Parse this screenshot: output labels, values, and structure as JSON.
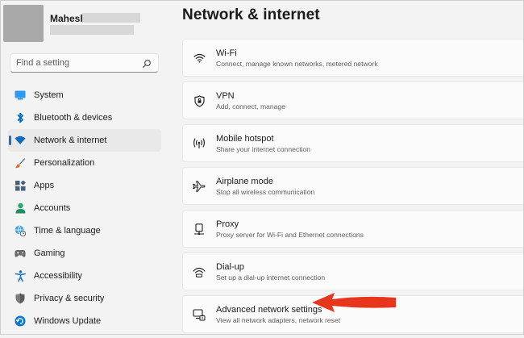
{
  "user": {
    "name": "Mahesh"
  },
  "search": {
    "placeholder": "Find a setting"
  },
  "sidebar": {
    "items": [
      {
        "label": "System",
        "icon": "system-icon",
        "color": "#0078d4"
      },
      {
        "label": "Bluetooth & devices",
        "icon": "bluetooth-icon",
        "color": "#0067c0"
      },
      {
        "label": "Network & internet",
        "icon": "wifi-icon",
        "color": "#0067c0",
        "selected": true
      },
      {
        "label": "Personalization",
        "icon": "brush-icon",
        "color": "#e06a2b"
      },
      {
        "label": "Apps",
        "icon": "apps-icon",
        "color": "#3a5f8a"
      },
      {
        "label": "Accounts",
        "icon": "person-icon",
        "color": "#2aa86a"
      },
      {
        "label": "Time & language",
        "icon": "globe-clock-icon",
        "color": "#1a8fd6"
      },
      {
        "label": "Gaming",
        "icon": "gamepad-icon",
        "color": "#6b6b6b"
      },
      {
        "label": "Accessibility",
        "icon": "accessibility-icon",
        "color": "#1a73c9"
      },
      {
        "label": "Privacy & security",
        "icon": "shield-icon",
        "color": "#6b6b6b"
      },
      {
        "label": "Windows Update",
        "icon": "update-icon",
        "color": "#0a78d1"
      }
    ]
  },
  "page": {
    "title": "Network & internet"
  },
  "cards": [
    {
      "title": "Wi-Fi",
      "desc": "Connect, manage known networks, metered network",
      "icon": "wifi-icon"
    },
    {
      "title": "VPN",
      "desc": "Add, connect, manage",
      "icon": "vpn-shield-icon"
    },
    {
      "title": "Mobile hotspot",
      "desc": "Share your internet connection",
      "icon": "hotspot-icon"
    },
    {
      "title": "Airplane mode",
      "desc": "Stop all wireless communication",
      "icon": "airplane-icon"
    },
    {
      "title": "Proxy",
      "desc": "Proxy server for Wi-Fi and Ethernet connections",
      "icon": "proxy-icon"
    },
    {
      "title": "Dial-up",
      "desc": "Set up a dial-up internet connection",
      "icon": "dialup-icon"
    },
    {
      "title": "Advanced network settings",
      "desc": "View all network adapters, network reset",
      "icon": "advanced-network-icon"
    }
  ],
  "annotation": {
    "arrow_color": "#e8361c"
  }
}
